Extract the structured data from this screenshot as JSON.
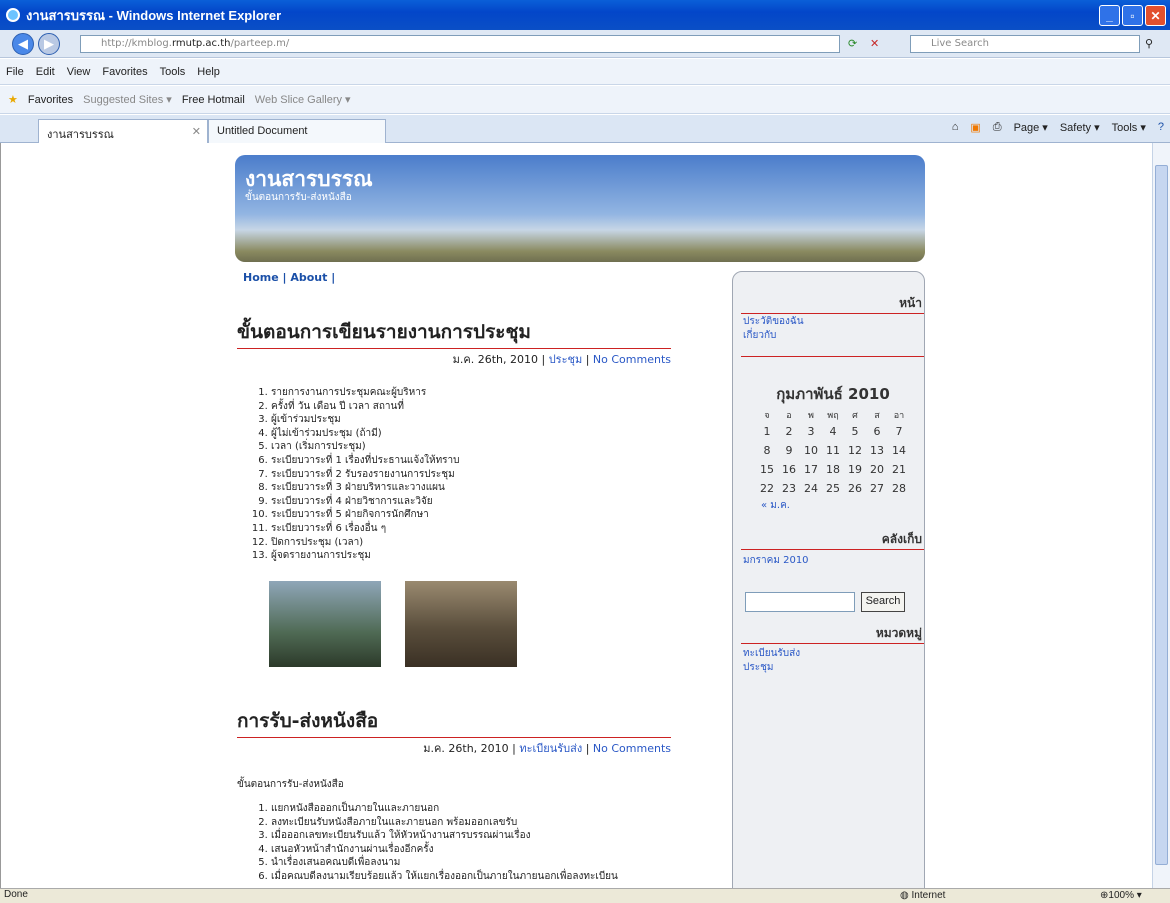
{
  "window": {
    "title": "งานสารบรรณ - Windows Internet Explorer"
  },
  "address": {
    "url_prefix": "http://kmblog.",
    "url_host": "rmutp.ac.th",
    "url_path": "/parteep.m/",
    "search_placeholder": "Live Search"
  },
  "menu": [
    "File",
    "Edit",
    "View",
    "Favorites",
    "Tools",
    "Help"
  ],
  "favorites": {
    "label": "Favorites",
    "items": [
      "Suggested Sites ▾",
      "Free Hotmail",
      "Web Slice Gallery ▾"
    ]
  },
  "tabs": [
    {
      "label": "งานสารบรรณ"
    },
    {
      "label": "Untitled Document"
    }
  ],
  "tab_tools": [
    "Page ▾",
    "Safety ▾",
    "Tools ▾"
  ],
  "blog": {
    "title": "งานสารบรรณ",
    "subtitle": "ขั้นตอนการรับ-ส่งหนังสือ",
    "nav": "Home | About |"
  },
  "posts": [
    {
      "title": "ขั้นตอนการเขียนรายงานการประชุม",
      "date": "ม.ค. 26th, 2010",
      "category": "ประชุม",
      "comments": "No Comments",
      "items": [
        "รายการงานการประชุมคณะผู้บริหาร",
        "ครั้งที่  วัน  เดือน  ปี  เวลา  สถานที่",
        "ผู้เข้าร่วมประชุม",
        "ผู้ไม่เข้าร่วมประชุม (ถ้ามี)",
        "เวลา (เริ่มการประชุม)",
        "ระเบียบวาระที่ 1  เรื่องที่ประธานแจ้งให้ทราบ",
        "ระเบียบวาระที่ 2  รับรองรายงานการประชุม",
        "ระเบียบวาระที่ 3  ฝ่ายบริหารและวางแผน",
        "ระเบียบวาระที่ 4  ฝ่ายวิชาการและวิจัย",
        "ระเบียบวาระที่ 5  ฝ่ายกิจการนักศึกษา",
        "ระเบียบวาระที่ 6  เรื่องอื่น ๆ",
        "ปิดการประชุม   (เวลา)",
        "ผู้จดรายงานการประชุม"
      ]
    },
    {
      "title": "การรับ-ส่งหนังสือ",
      "date": "ม.ค. 26th, 2010",
      "category": "ทะเบียนรับส่ง",
      "comments": "No Comments",
      "intro": "ขั้นตอนการรับ-ส่งหนังสือ",
      "items": [
        "แยกหนังสือออกเป็นภายในและภายนอก",
        "ลงทะเบียนรับหนังสือภายในและภายนอก พร้อมออกเลขรับ",
        "เมื่อออกเลขทะเบียนรับแล้ว ให้หัวหน้างานสารบรรณผ่านเรื่อง",
        "เสนอหัวหน้าสำนักงานผ่านเรื่องอีกครั้ง",
        "นำเรื่องเสนอคณบดีเพื่อลงนาม",
        "เมื่อคณบดีลงนามเรียบร้อยแล้ว ให้แยกเรื่องออกเป็นภายในภายนอกเพื่อลงทะเบียน"
      ]
    }
  ],
  "sidebar": {
    "pages_title": "หน้า",
    "pages": [
      "ประวัติของฉัน",
      "เกี่ยวกับ"
    ],
    "calendar": {
      "month": "กุมภาพันธ์ 2010",
      "days": [
        "จ",
        "อ",
        "พ",
        "พฤ",
        "ศ",
        "ส",
        "อา"
      ],
      "weeks": [
        [
          "1",
          "2",
          "3",
          "4",
          "5",
          "6",
          "7"
        ],
        [
          "8",
          "9",
          "10",
          "11",
          "12",
          "13",
          "14"
        ],
        [
          "15",
          "16",
          "17",
          "18",
          "19",
          "20",
          "21"
        ],
        [
          "22",
          "23",
          "24",
          "25",
          "26",
          "27",
          "28"
        ]
      ],
      "prev": "« ม.ค."
    },
    "archive_title": "คลังเก็บ",
    "archive": "มกราคม 2010",
    "search_button": "Search",
    "cat_title": "หมวดหมู่",
    "cats": [
      "ทะเบียนรับส่ง",
      "ประชุม"
    ]
  },
  "status": {
    "left": "Done",
    "zone": "Internet",
    "zoom": "100%"
  }
}
